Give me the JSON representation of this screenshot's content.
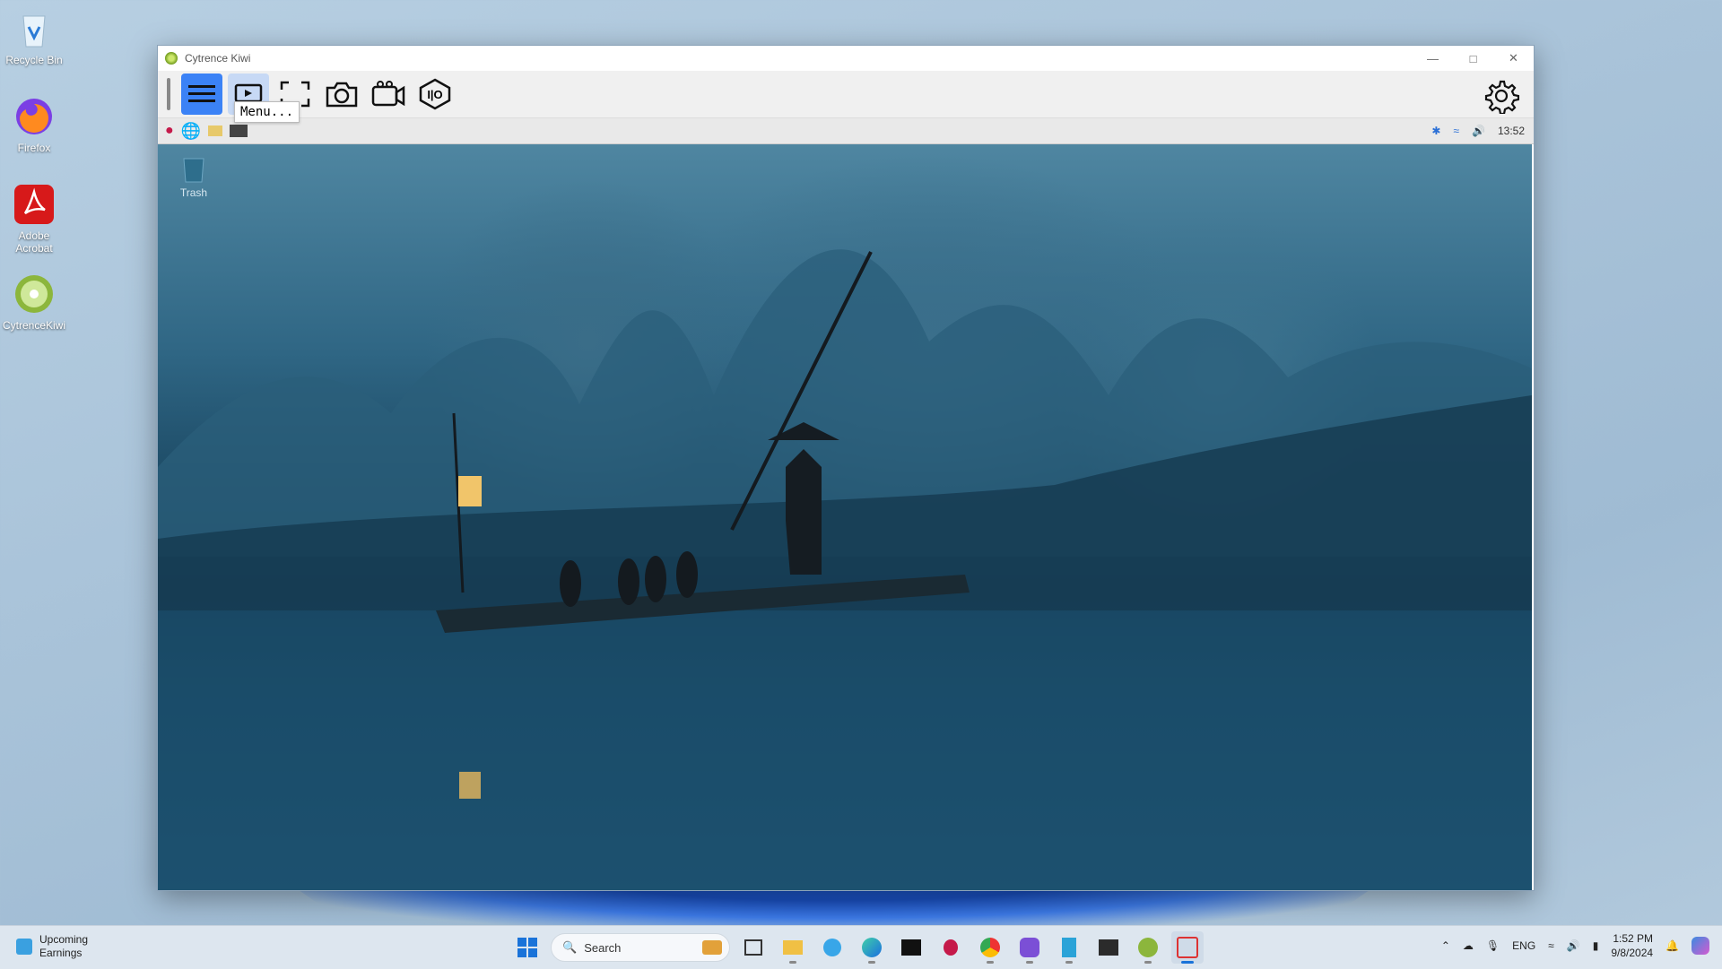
{
  "desktop": {
    "icons": [
      {
        "label": "Recycle Bin"
      },
      {
        "label": "Firefox"
      },
      {
        "label": "Adobe Acrobat"
      },
      {
        "label": "CytrenceKiwi"
      }
    ]
  },
  "window": {
    "title": "Cytrence Kiwi",
    "tooltip": "Menu..."
  },
  "remote": {
    "clock": "13:52",
    "trash_label": "Trash"
  },
  "taskbar": {
    "weather_title": "Upcoming",
    "weather_sub": "Earnings",
    "search_placeholder": "Search",
    "language": "ENG",
    "time": "1:52 PM",
    "date": "9/8/2024"
  },
  "colors": {
    "accent": "#3b82f6"
  }
}
